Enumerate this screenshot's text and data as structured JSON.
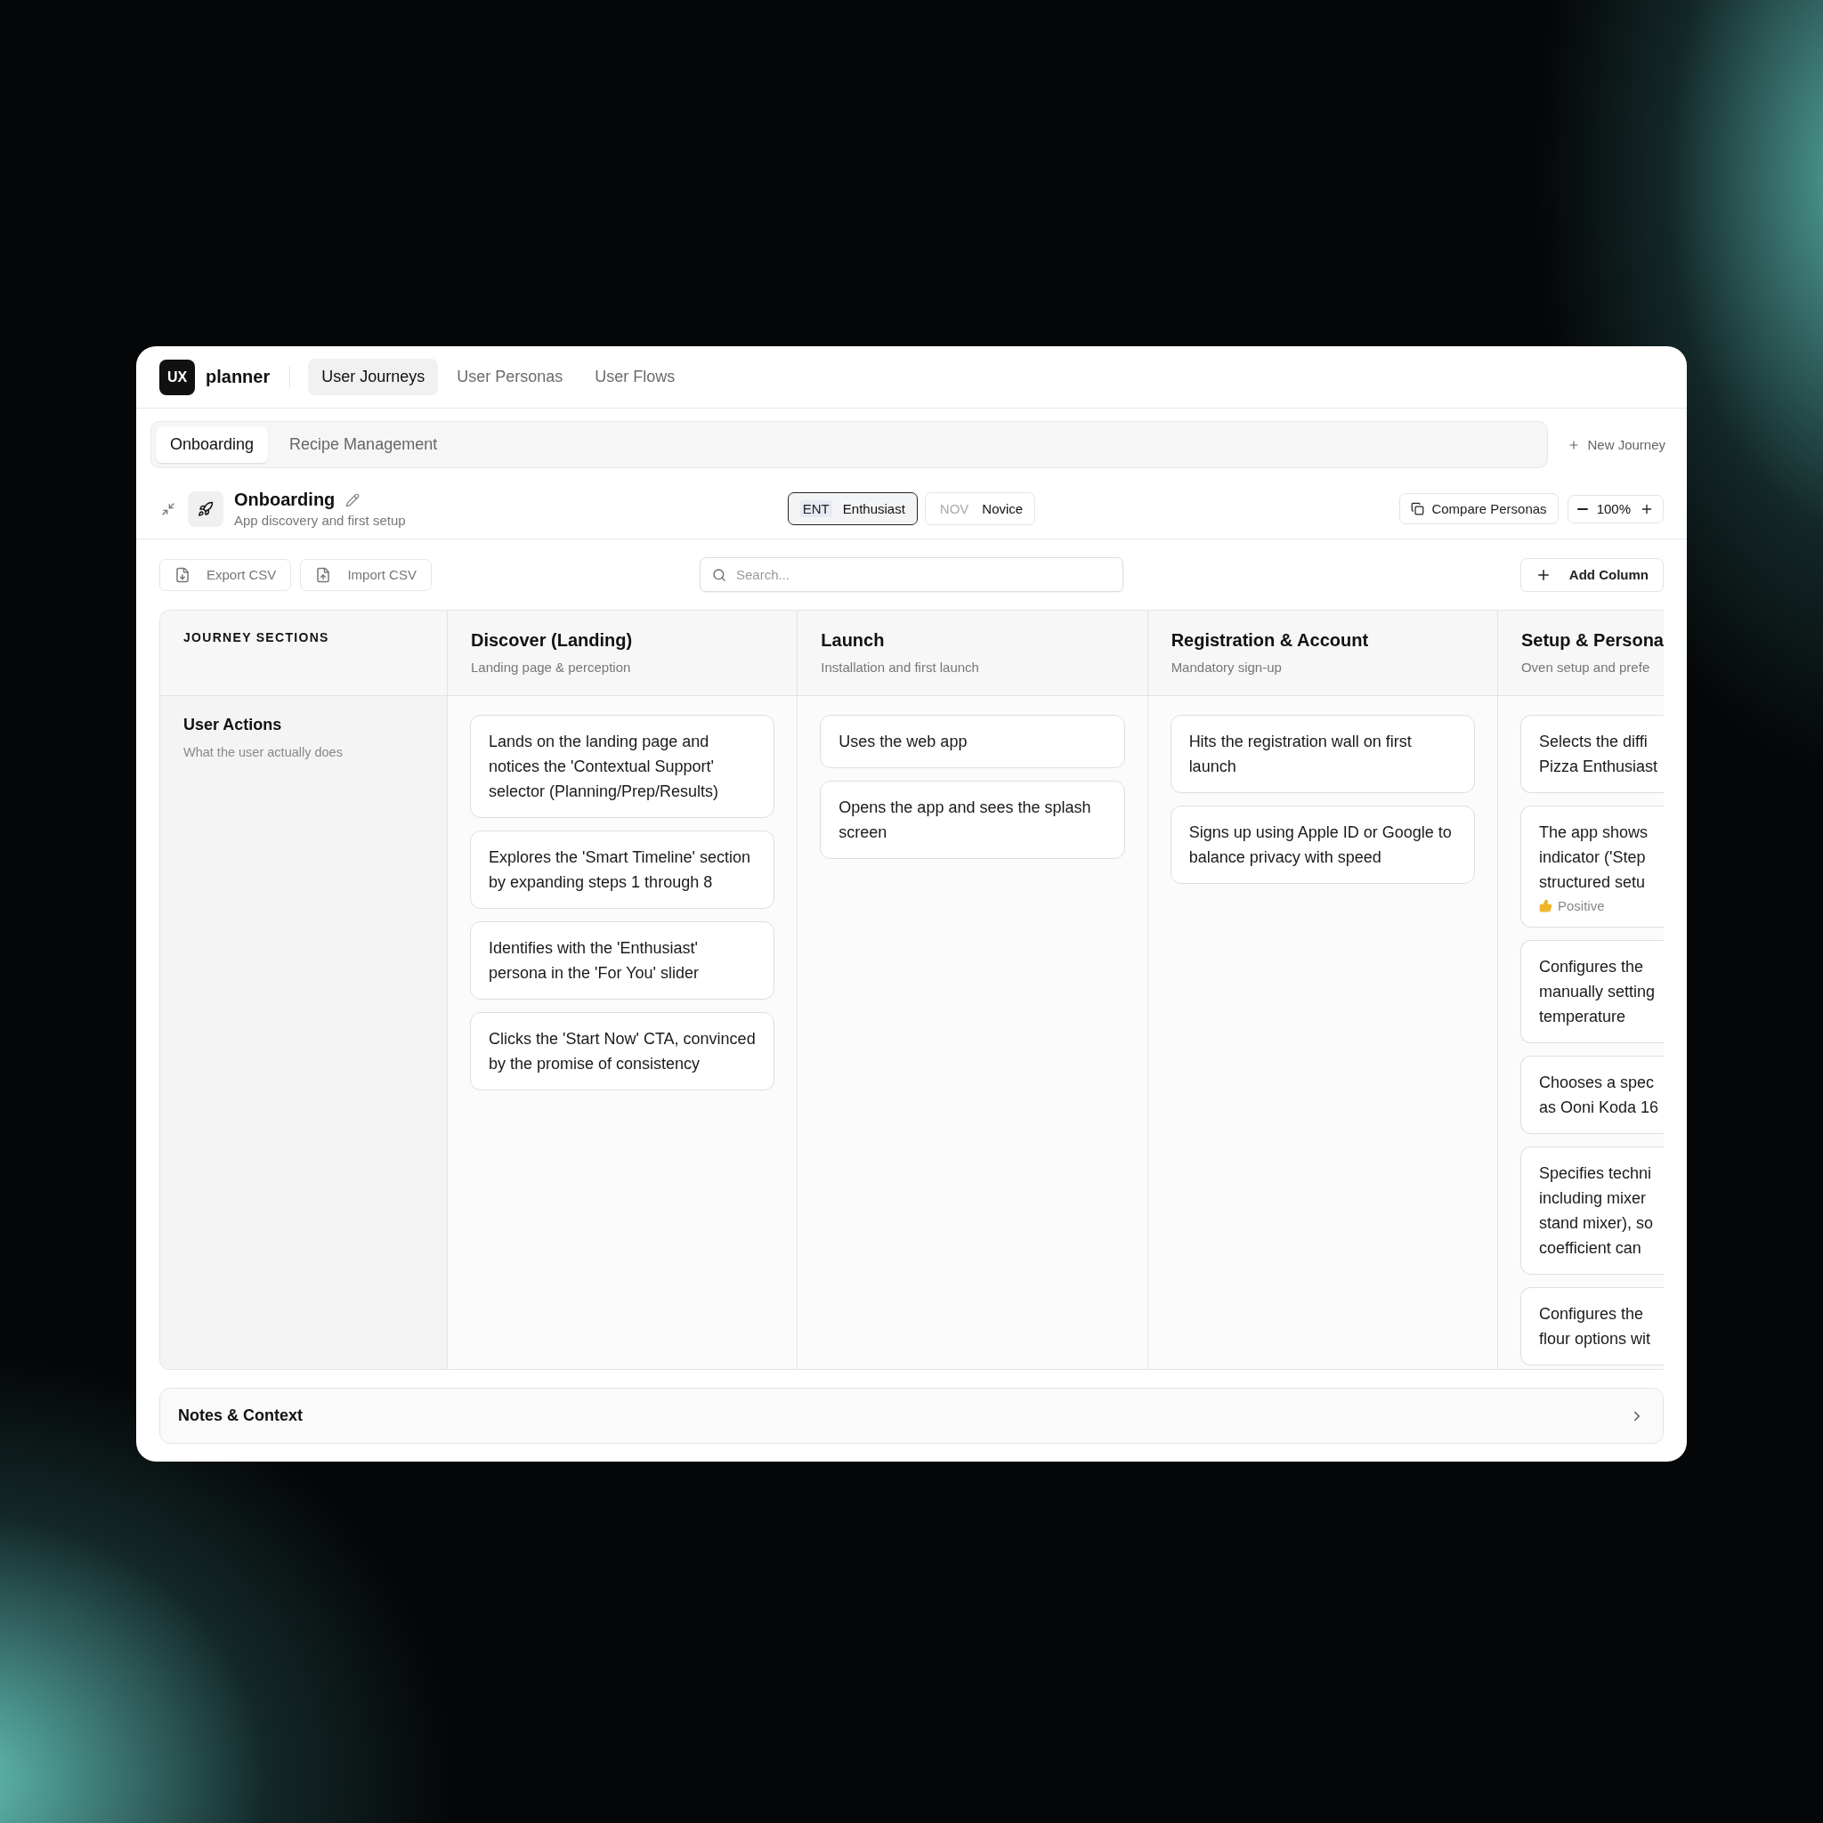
{
  "app": {
    "logo_badge": "UX",
    "logo_text": "planner"
  },
  "nav_tabs": [
    {
      "label": "User Journeys",
      "selected": true
    },
    {
      "label": "User Personas",
      "selected": false
    },
    {
      "label": "User Flows",
      "selected": false
    }
  ],
  "journey_tabs": [
    {
      "label": "Onboarding",
      "selected": true
    },
    {
      "label": "Recipe Management",
      "selected": false
    }
  ],
  "new_journey": "New Journey",
  "journey": {
    "title": "Onboarding",
    "subtitle": "App discovery and first setup"
  },
  "personas": [
    {
      "code": "ENT",
      "name": "Enthusiast",
      "selected": true
    },
    {
      "code": "NOV",
      "name": "Novice",
      "selected": false
    }
  ],
  "compare_button": "Compare Personas",
  "zoom": "100%",
  "toolbar": {
    "export": "Export CSV",
    "import": "Import CSV",
    "search_placeholder": "Search...",
    "add_column": "Add Column"
  },
  "board": {
    "sections_header": "JOURNEY SECTIONS",
    "rows": [
      {
        "title": "User Actions",
        "subtitle": "What the user actually does"
      }
    ],
    "columns": [
      {
        "title": "Discover (Landing)",
        "subtitle": "Landing page & perception",
        "cut": false,
        "cards": [
          {
            "text": "Lands on the landing page and notices the 'Contextual Support' selector (Planning/Prep/Results)"
          },
          {
            "text": "Explores the 'Smart Timeline' section by expanding steps 1 through 8"
          },
          {
            "text": "Identifies with the 'Enthusiast' persona in the 'For You' slider"
          },
          {
            "text": "Clicks the 'Start Now' CTA, convinced by the promise of consistency"
          }
        ]
      },
      {
        "title": "Launch",
        "subtitle": "Installation and first launch",
        "cut": false,
        "cards": [
          {
            "text": "Uses the web app"
          },
          {
            "text": "Opens the app and sees the splash screen"
          }
        ]
      },
      {
        "title": "Registration & Account",
        "subtitle": "Mandatory sign-up",
        "cut": false,
        "cards": [
          {
            "text": "Hits the registration wall on first launch"
          },
          {
            "text": "Signs up using Apple ID or Google to balance privacy with speed"
          }
        ]
      },
      {
        "title": "Setup & Persona",
        "subtitle": "Oven setup and prefe",
        "cut": true,
        "cards": [
          {
            "lines": [
              "Selects the diffi",
              "Pizza Enthusiast"
            ]
          },
          {
            "lines": [
              "The app shows",
              "indicator ('Step",
              "structured setu"
            ],
            "sentiment": {
              "kind": "positive",
              "label": "Positive"
            }
          },
          {
            "lines": [
              "Configures the",
              "manually setting",
              "temperature"
            ]
          },
          {
            "lines": [
              "Chooses a spec",
              "as Ooni Koda 16"
            ]
          },
          {
            "lines": [
              "Specifies techni",
              "including mixer",
              "stand mixer), so",
              "coefficient can"
            ]
          },
          {
            "lines": [
              "Configures the",
              "flour options wit"
            ]
          }
        ]
      }
    ]
  },
  "notes": {
    "title": "Notes & Context",
    "expanded": false
  }
}
